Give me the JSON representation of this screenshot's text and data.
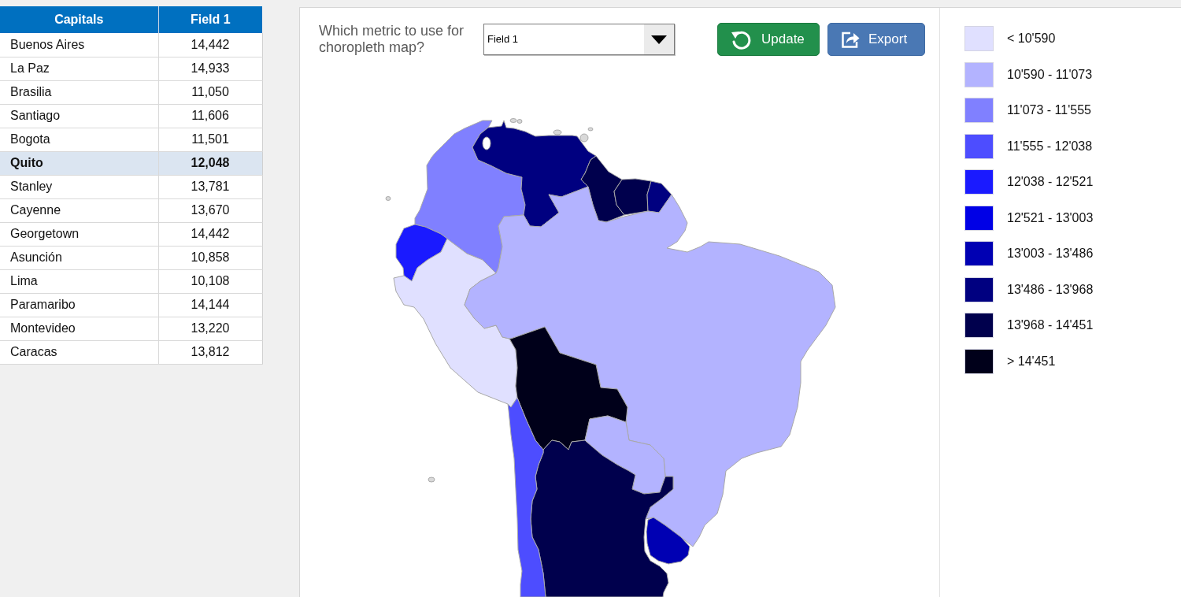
{
  "table": {
    "columns": [
      "Capitals",
      "Field 1"
    ],
    "rows": [
      {
        "cells": [
          "Buenos Aires",
          "14,442"
        ],
        "selected": false
      },
      {
        "cells": [
          "La Paz",
          "14,933"
        ],
        "selected": false
      },
      {
        "cells": [
          "Brasilia",
          "11,050"
        ],
        "selected": false
      },
      {
        "cells": [
          "Santiago",
          "11,606"
        ],
        "selected": false
      },
      {
        "cells": [
          "Bogota",
          "11,501"
        ],
        "selected": false
      },
      {
        "cells": [
          "Quito",
          "12,048"
        ],
        "selected": true
      },
      {
        "cells": [
          "Stanley",
          "13,781"
        ],
        "selected": false
      },
      {
        "cells": [
          "Cayenne",
          "13,670"
        ],
        "selected": false
      },
      {
        "cells": [
          "Georgetown",
          "14,442"
        ],
        "selected": false
      },
      {
        "cells": [
          "Asunción",
          "10,858"
        ],
        "selected": false
      },
      {
        "cells": [
          "Lima",
          "10,108"
        ],
        "selected": false
      },
      {
        "cells": [
          "Paramaribo",
          "14,144"
        ],
        "selected": false
      },
      {
        "cells": [
          "Montevideo",
          "13,220"
        ],
        "selected": false
      },
      {
        "cells": [
          "Caracas",
          "13,812"
        ],
        "selected": false
      }
    ]
  },
  "controls": {
    "prompt": "Which metric to use for choropleth map?",
    "dropdown": {
      "value": "Field 1"
    },
    "buttons": [
      {
        "label": "Update",
        "kind": "update"
      },
      {
        "label": "Export",
        "kind": "export"
      }
    ]
  },
  "map": {
    "regions": [
      {
        "color": "#8080ff"
      },
      {
        "color": "#000080"
      },
      {
        "color": "#00004d"
      },
      {
        "color": "#00004d"
      },
      {
        "color": "#000080"
      },
      {
        "color": "#1a1aff"
      },
      {
        "color": "#e0e0ff"
      },
      {
        "color": "#b3b3ff"
      },
      {
        "color": "#00001a"
      },
      {
        "color": "#b3b3ff"
      },
      {
        "color": "#00004d"
      },
      {
        "color": "#4d4dff"
      },
      {
        "color": "#0000b3"
      },
      {
        "color": "#d9d9d9"
      },
      {
        "color": "#d9d9d9"
      },
      {
        "color": "#d9d9d9"
      },
      {
        "color": "#d9d9d9"
      },
      {
        "color": "#d9d9d9"
      },
      {
        "color": "#d9d9d9"
      },
      {
        "color": "#d9d9d9"
      }
    ]
  },
  "legend": {
    "items": [
      {
        "label": "< 10'590",
        "color": "#e0e0ff"
      },
      {
        "label": "10'590 - 11'073",
        "color": "#b3b3ff"
      },
      {
        "label": "11'073 - 11'555",
        "color": "#8080ff"
      },
      {
        "label": "11'555 - 12'038",
        "color": "#4d4dff"
      },
      {
        "label": "12'038 - 12'521",
        "color": "#1a1aff"
      },
      {
        "label": "12'521 - 13'003",
        "color": "#0000e6"
      },
      {
        "label": "13'003 - 13'486",
        "color": "#0000b3"
      },
      {
        "label": "13'486 - 13'968",
        "color": "#000080"
      },
      {
        "label": "13'968 - 14'451",
        "color": "#00004d"
      },
      {
        "label": "> 14'451",
        "color": "#00001a"
      }
    ]
  }
}
